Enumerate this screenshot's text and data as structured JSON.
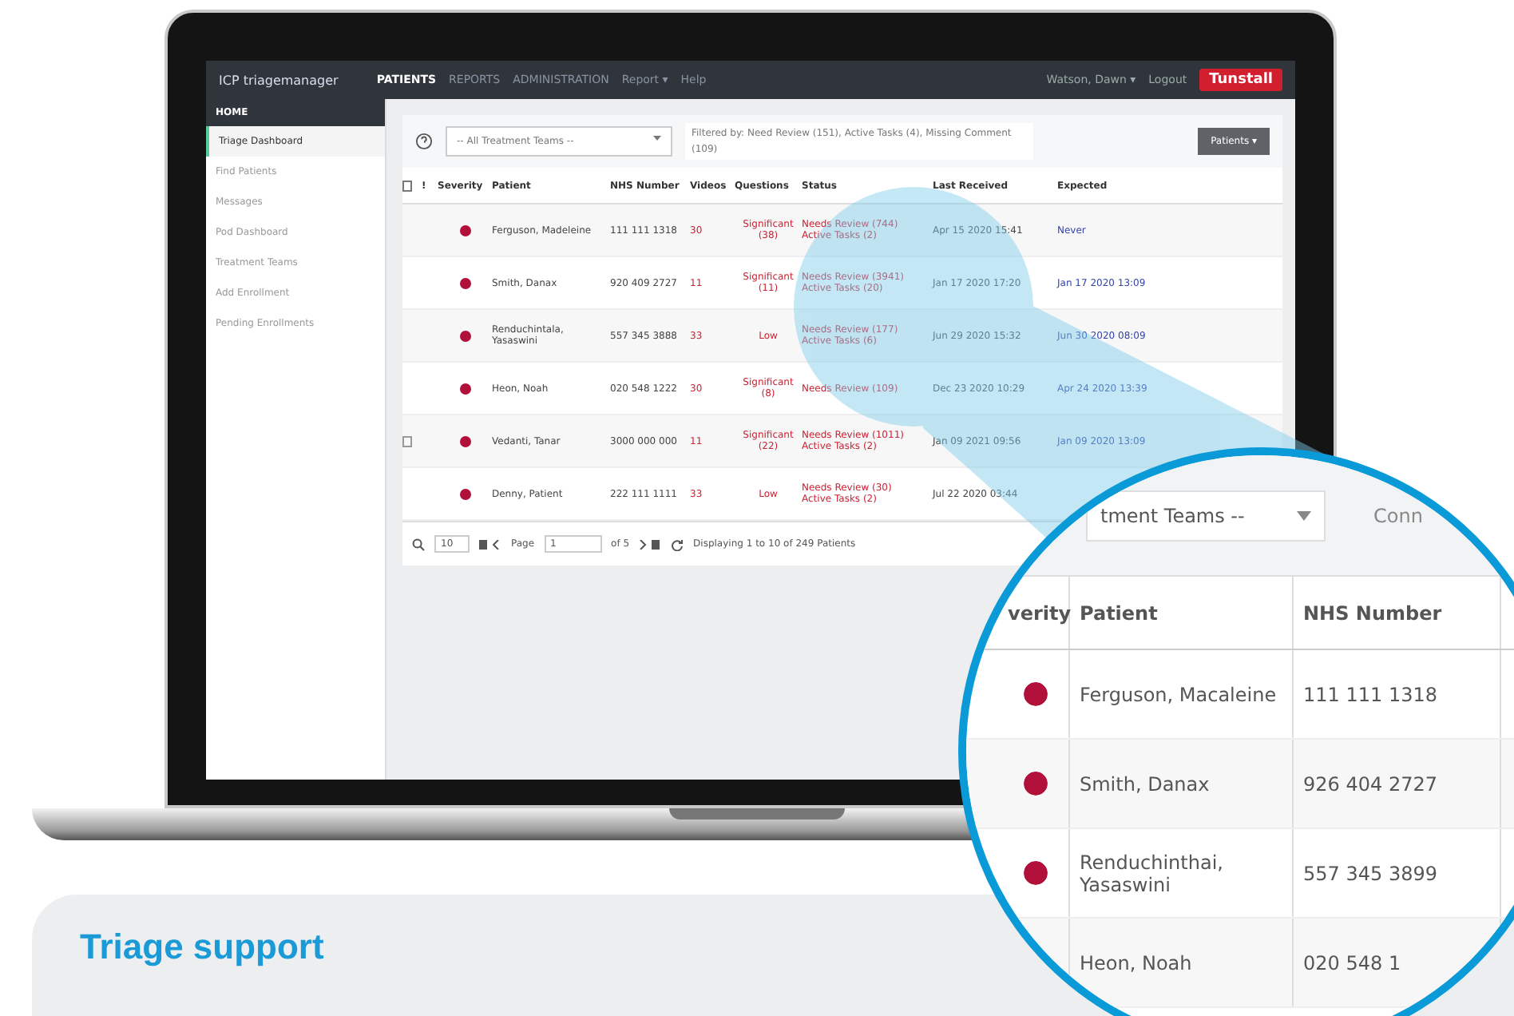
{
  "app": {
    "brand": "ICP triagemanager",
    "nav": [
      {
        "label": "PATIENTS",
        "selected": true
      },
      {
        "label": "REPORTS",
        "selected": false
      },
      {
        "label": "ADMINISTRATION",
        "selected": false
      },
      {
        "label": "Report ▾",
        "selected": false
      },
      {
        "label": "Help",
        "selected": false
      }
    ],
    "user": "Watson, Dawn ▾",
    "logout": "Logout",
    "logo": "Tunstall"
  },
  "sidebar": {
    "heading": "HOME",
    "items": [
      {
        "label": "Triage Dashboard",
        "selected": true
      },
      {
        "label": "Find Patients",
        "selected": false
      },
      {
        "label": "Messages",
        "selected": false
      },
      {
        "label": "Pod Dashboard",
        "selected": false
      },
      {
        "label": "Treatment Teams",
        "selected": false
      },
      {
        "label": "Add Enrollment",
        "selected": false
      },
      {
        "label": "Pending Enrollments",
        "selected": false
      }
    ]
  },
  "toolbar": {
    "team_select": "-- All Treatment Teams --",
    "filter_text": "Filtered by: Need Review (151), Active Tasks (4), Missing Comment (109)",
    "button": "Patients ▾"
  },
  "table": {
    "columns": [
      "!",
      "Severity",
      "Patient",
      "NHS Number",
      "Videos",
      "Questions",
      "Status",
      "Last Received",
      "Expected"
    ],
    "rows": [
      {
        "note": false,
        "color": "#b0103a",
        "patient": "Ferguson, Madeleine",
        "nhs": "111 111 1318",
        "videos": "30",
        "questions": "Significant (38)",
        "status": [
          "Needs Review (744)",
          "Active Tasks (2)"
        ],
        "last": "Apr 15 2020 15:41",
        "expected": "Never"
      },
      {
        "note": false,
        "color": "#b0103a",
        "patient": "Smith, Danax",
        "nhs": "920 409 2727",
        "videos": "11",
        "questions": "Significant (11)",
        "status": [
          "Needs Review (3941)",
          "Active Tasks (20)"
        ],
        "last": "Jan 17 2020 17:20",
        "expected": "Jan 17 2020 13:09"
      },
      {
        "note": false,
        "color": "#b0103a",
        "patient": "Renduchintala, Yasaswini",
        "nhs": "557 345 3888",
        "videos": "33",
        "questions": "Low",
        "status": [
          "Needs Review (177)",
          "Active Tasks (6)"
        ],
        "last": "Jun 29 2020 15:32",
        "expected": "Jun 30 2020 08:09"
      },
      {
        "note": false,
        "color": "#b0103a",
        "patient": "Heon, Noah",
        "nhs": "020 548 1222",
        "videos": "30",
        "questions": "Significant (8)",
        "status": [
          "Needs Review (109)"
        ],
        "last": "Dec 23 2020 10:29",
        "expected": "Apr 24 2020 13:39"
      },
      {
        "note": true,
        "color": "#b0103a",
        "patient": "Vedanti, Tanar",
        "nhs": "3000 000 000",
        "videos": "11",
        "questions": "Significant (22)",
        "status": [
          "Needs Review (1011)",
          "Active Tasks (2)"
        ],
        "last": "Jan 09 2021 09:56",
        "expected": "Jan 09 2020 13:09"
      },
      {
        "note": false,
        "color": "#b0103a",
        "patient": "Denny, Patient",
        "nhs": "222 111 1111",
        "videos": "33",
        "questions": "Low",
        "status": [
          "Needs Review (30)",
          "Active Tasks (2)"
        ],
        "last": "Jul 22 2020 03:44"
      }
    ]
  },
  "pager": {
    "page_size": "10",
    "page_label": "Page",
    "page": "1",
    "of": "of 5",
    "summary": "Displaying 1 to 10 of 249 Patients"
  },
  "magnifier": {
    "team_select": "tment Teams --",
    "filter_text": "Conn",
    "columns": [
      "verity",
      "Patient",
      "NHS Number"
    ],
    "rows": [
      {
        "color": "#b0103a",
        "patient": "Ferguson, Macaleine",
        "nhs": "111 111 1318"
      },
      {
        "color": "#b0103a",
        "patient": "Smith, Danax",
        "nhs": "926 404 2727"
      },
      {
        "color": "#b0103a",
        "patient": "Renduchinthai, Yasaswini",
        "nhs": "557 345 3899"
      },
      {
        "patient": "Heon, Noah",
        "nhs": "020 548 1"
      }
    ]
  },
  "card": {
    "title": "Triage support"
  }
}
